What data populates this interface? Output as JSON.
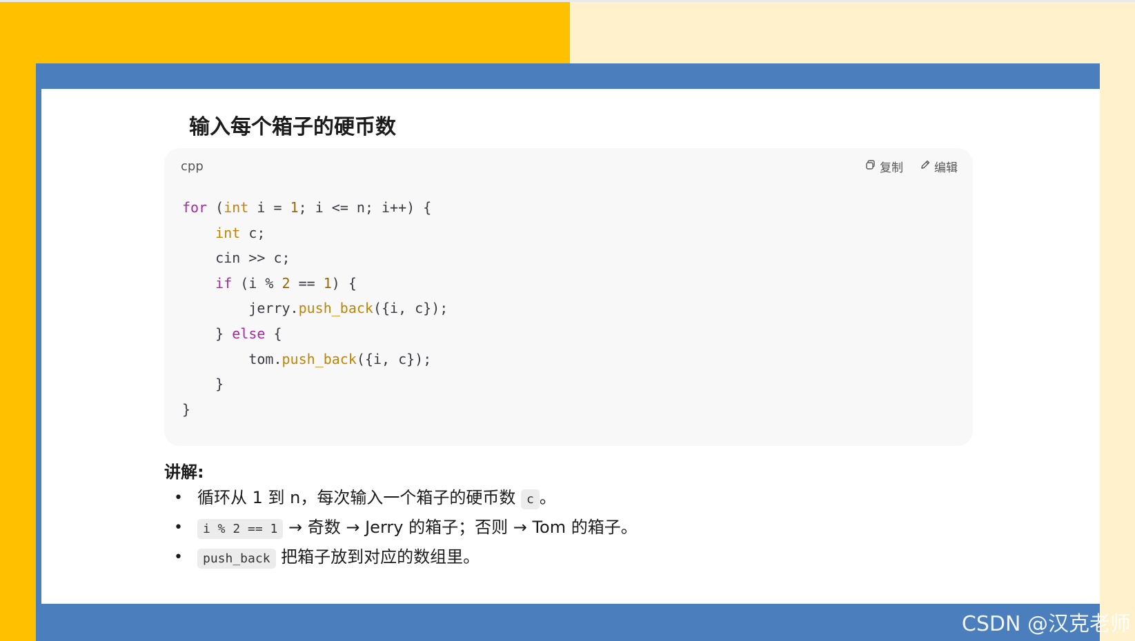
{
  "title": "输入每个箱子的硬币数",
  "code_block": {
    "language": "cpp",
    "copy_label": "复制",
    "edit_label": "编辑",
    "lines": {
      "l1": {
        "kw": "for",
        "t1": " (",
        "ty": "int",
        "t2": " i = ",
        "num": "1",
        "t3": "; i <= n; i++) {"
      },
      "l2": {
        "ty": "int",
        "t1": " c;"
      },
      "l3": {
        "t1": "cin >> c;"
      },
      "l4": {
        "kw": "if",
        "t1": " (i % ",
        "num1": "2",
        "t2": " == ",
        "num2": "1",
        "t3": ") {"
      },
      "l5": {
        "t1": "jerry.",
        "fn": "push_back",
        "t2": "({i, c});"
      },
      "l6": {
        "t1": "} ",
        "kw": "else",
        "t2": " {"
      },
      "l7": {
        "t1": "tom.",
        "fn": "push_back",
        "t2": "({i, c});"
      },
      "l8": {
        "t1": "}"
      },
      "l9": {
        "t1": "}"
      }
    }
  },
  "explanation": {
    "heading": "讲解:",
    "items": [
      {
        "before": "循环从 1 到 n，每次输入一个箱子的硬币数 ",
        "code": "c",
        "after": "。"
      },
      {
        "before": "",
        "code": "i % 2 == 1",
        "after": " → 奇数 → Jerry 的箱子；否则 → Tom 的箱子。"
      },
      {
        "before": "",
        "code": "push_back",
        "after": " 把箱子放到对应的数组里。"
      }
    ],
    "bullet": "•"
  },
  "watermark": "CSDN @汉克老师",
  "colors": {
    "left_background": "#ffc000",
    "right_background": "#fff1cc",
    "slide_band": "#4a7ebd",
    "code_background": "#f8f8f8",
    "keyword": "#a626a4",
    "type": "#c18401"
  }
}
